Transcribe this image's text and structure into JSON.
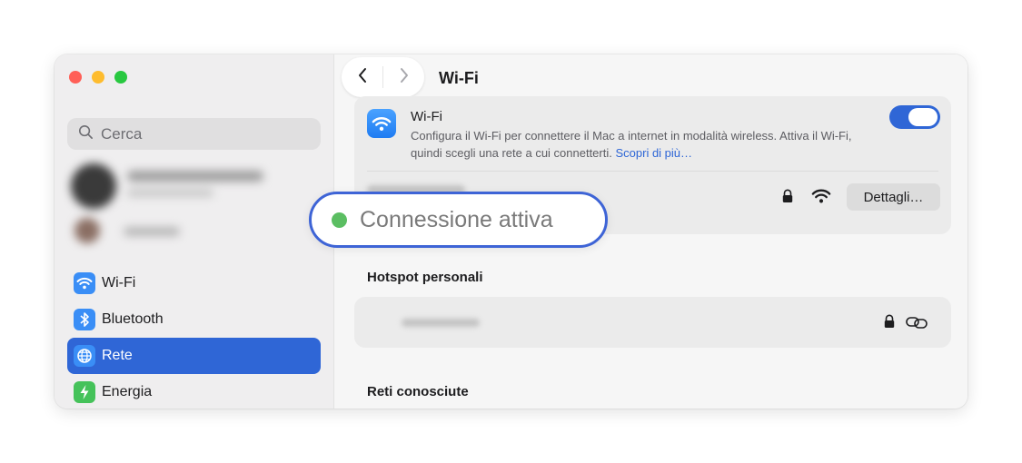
{
  "window": {
    "traffic_lights": [
      "close",
      "minimize",
      "zoom"
    ]
  },
  "sidebar": {
    "search": {
      "placeholder": "Cerca",
      "icon": "magnifier-icon"
    },
    "items": [
      {
        "label": "Wi-Fi",
        "icon": "wifi-icon",
        "color": "#3a8ef6",
        "active": false
      },
      {
        "label": "Bluetooth",
        "icon": "bluetooth-icon",
        "color": "#3a8ef6",
        "active": false
      },
      {
        "label": "Rete",
        "icon": "globe-icon",
        "color": "#3a8ef6",
        "active": true
      },
      {
        "label": "Energia",
        "icon": "bolt-icon",
        "color": "#45c25a",
        "active": false
      }
    ]
  },
  "main": {
    "title": "Wi-Fi",
    "wifi_card": {
      "title": "Wi-Fi",
      "description": "Configura il Wi-Fi per connettere il Mac a internet in modalità wireless. Attiva il Wi-Fi, quindi scegli una rete a cui connetterti.",
      "link": "Scopri di più…",
      "toggle_on": true,
      "details_button": "Dettagli…"
    },
    "hotspot_title": "Hotspot personali",
    "known_networks_title": "Reti conosciute"
  },
  "overlay": {
    "status_text": "Connessione attiva",
    "status_color": "#5bbe62",
    "border_color": "#3e64d6"
  },
  "colors": {
    "accent": "#2f66d6"
  }
}
